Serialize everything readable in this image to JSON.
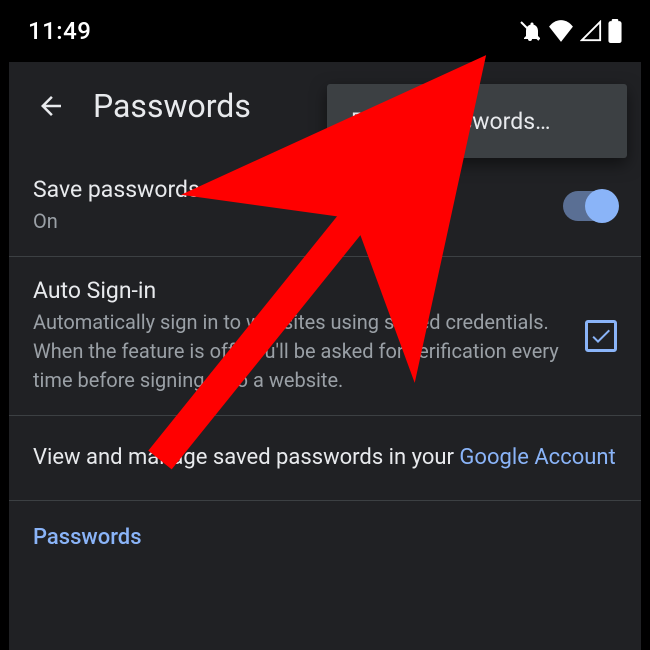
{
  "statusbar": {
    "time": "11:49"
  },
  "appbar": {
    "title": "Passwords"
  },
  "menu": {
    "export_label": "Export passwords…"
  },
  "save_passwords": {
    "title": "Save passwords",
    "status": "On",
    "enabled": true
  },
  "auto_signin": {
    "title": "Auto Sign-in",
    "description": "Automatically sign in to websites using stored credentials. When the feature is off, you'll be asked for verification every time before signing in to a website.",
    "checked": true
  },
  "account_link": {
    "prefix": "View and manage saved passwords in your ",
    "link": "Google Account"
  },
  "section": {
    "passwords_label": "Passwords"
  },
  "colors": {
    "accent": "#8ab4f8",
    "bg": "#202124",
    "menu": "#3c4043",
    "muted": "#9aa0a6"
  }
}
